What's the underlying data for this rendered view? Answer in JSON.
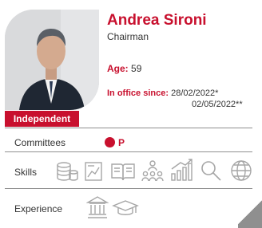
{
  "profile": {
    "name": "Andrea Sironi",
    "role": "Chairman",
    "age_label": "Age:",
    "age_value": "59",
    "office_label": "In office since:",
    "office_date_1": "28/02/2022*",
    "office_date_2": "02/05/2022**",
    "badge": "Independent"
  },
  "rows": {
    "committees_label": "Committees",
    "committee_value": "P",
    "skills_label": "Skills",
    "experience_label": "Experience"
  },
  "icons": {
    "skills": [
      "coins-stack-icon",
      "chart-document-icon",
      "open-book-icon",
      "team-icon",
      "growth-bars-icon",
      "magnifier-icon",
      "globe-icon"
    ],
    "experience": [
      "institution-icon",
      "graduation-cap-icon"
    ]
  },
  "colors": {
    "accent": "#c8102e",
    "text": "#333333",
    "icon": "#a6a6a6",
    "rule": "#8f8f8f"
  }
}
